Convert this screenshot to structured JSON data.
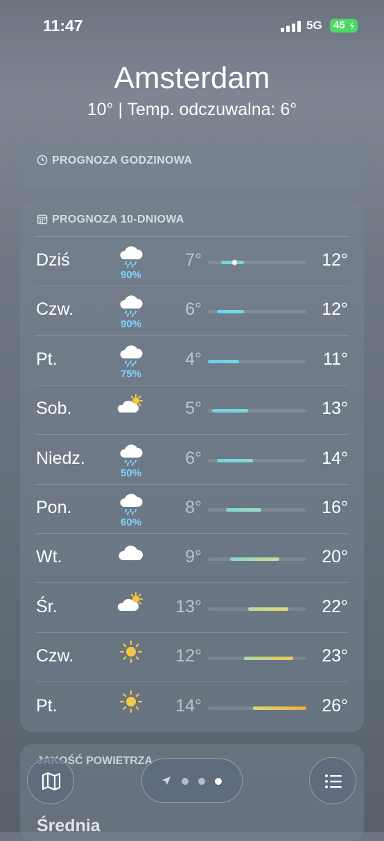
{
  "status": {
    "time": "11:47",
    "network": "5G",
    "battery": "45"
  },
  "location": {
    "city": "Amsterdam",
    "summary": "10°  |  Temp. odczuwalna: 6°"
  },
  "hourly": {
    "title": "PROGNOZA GODZINOWA"
  },
  "forecast": {
    "title": "PROGNOZA 10-DNIOWA",
    "range": [
      4,
      26
    ],
    "days": [
      {
        "day": "Dziś",
        "icon": "rain-cloud-icon",
        "precip": "90%",
        "low": "7°",
        "high": "12°",
        "lo": 7,
        "hi": 12,
        "current": 10,
        "c1": "#6fd5e8",
        "c2": "#6fd5e8"
      },
      {
        "day": "Czw.",
        "icon": "rain-cloud-icon",
        "precip": "90%",
        "low": "6°",
        "high": "12°",
        "lo": 6,
        "hi": 12,
        "c1": "#6fd5e8",
        "c2": "#7ad6dc"
      },
      {
        "day": "Pt.",
        "icon": "rain-cloud-icon",
        "precip": "75%",
        "low": "4°",
        "high": "11°",
        "lo": 4,
        "hi": 11,
        "c1": "#68cfec",
        "c2": "#72d6e4"
      },
      {
        "day": "Sob.",
        "icon": "partly-sunny-icon",
        "precip": "",
        "low": "5°",
        "high": "13°",
        "lo": 5,
        "hi": 13,
        "c1": "#6fd3e8",
        "c2": "#7fd8d8"
      },
      {
        "day": "Niedz.",
        "icon": "rain-cloud-icon",
        "precip": "50%",
        "low": "6°",
        "high": "14°",
        "lo": 6,
        "hi": 14,
        "c1": "#72d5e2",
        "c2": "#88dad0"
      },
      {
        "day": "Pon.",
        "icon": "rain-cloud-icon",
        "precip": "60%",
        "low": "8°",
        "high": "16°",
        "lo": 8,
        "hi": 16,
        "c1": "#80d8d2",
        "c2": "#9edcbe"
      },
      {
        "day": "Wt.",
        "icon": "cloud-icon",
        "precip": "",
        "low": "9°",
        "high": "20°",
        "lo": 9,
        "hi": 20,
        "c1": "#86d9cc",
        "c2": "#c8de8e"
      },
      {
        "day": "Śr.",
        "icon": "partly-sunny-icon",
        "precip": "",
        "low": "13°",
        "high": "22°",
        "lo": 13,
        "hi": 22,
        "c1": "#b8dc9c",
        "c2": "#e8d670"
      },
      {
        "day": "Czw.",
        "icon": "sun-icon",
        "precip": "",
        "low": "12°",
        "high": "23°",
        "lo": 12,
        "hi": 23,
        "c1": "#a6dba8",
        "c2": "#f0c850"
      },
      {
        "day": "Pt.",
        "icon": "sun-icon",
        "precip": "",
        "low": "14°",
        "high": "26°",
        "lo": 14,
        "hi": 26,
        "c1": "#e0d670",
        "c2": "#f2aa3c"
      }
    ]
  },
  "air_quality": {
    "title": "JAKOŚĆ POWIETRZA",
    "value": "Średnia"
  }
}
